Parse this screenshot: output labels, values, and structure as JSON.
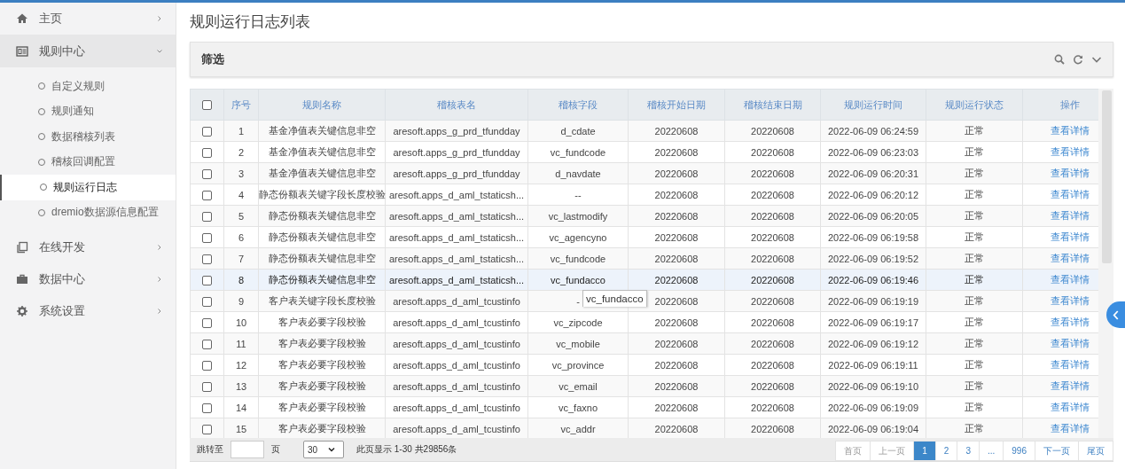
{
  "sidebar": {
    "items": [
      {
        "label": "主页",
        "kind": "home",
        "expanded": false
      },
      {
        "label": "规则中心",
        "kind": "card",
        "expanded": true,
        "children": [
          {
            "label": "自定义规则",
            "selected": false
          },
          {
            "label": "规则通知",
            "selected": false
          },
          {
            "label": "数据稽核列表",
            "selected": false
          },
          {
            "label": "稽核回调配置",
            "selected": false
          },
          {
            "label": "规则运行日志",
            "selected": true
          },
          {
            "label": "dremio数据源信息配置",
            "selected": false
          }
        ]
      },
      {
        "label": "在线开发",
        "kind": "copy",
        "expanded": false
      },
      {
        "label": "数据中心",
        "kind": "briefcase",
        "expanded": false
      },
      {
        "label": "系统设置",
        "kind": "gear",
        "expanded": false
      }
    ]
  },
  "page_title": "规则运行日志列表",
  "filter": {
    "title": "筛选"
  },
  "table": {
    "select_all_checked": false,
    "columns": [
      "序号",
      "规则名称",
      "稽核表名",
      "稽核字段",
      "稽核开始日期",
      "稽核结束日期",
      "规则运行时间",
      "规则运行状态",
      "操作"
    ],
    "rows": [
      {
        "checked": false,
        "hovered": false,
        "cells": [
          "1",
          "基金净值表关键信息非空",
          "aresoft.apps_g_prd_tfundday",
          "d_cdate",
          "20220608",
          "20220608",
          "2022-06-09 06:24:59",
          "正常"
        ],
        "action": "查看详情"
      },
      {
        "checked": false,
        "hovered": false,
        "cells": [
          "2",
          "基金净值表关键信息非空",
          "aresoft.apps_g_prd_tfundday",
          "vc_fundcode",
          "20220608",
          "20220608",
          "2022-06-09 06:23:03",
          "正常"
        ],
        "action": "查看详情"
      },
      {
        "checked": false,
        "hovered": false,
        "cells": [
          "3",
          "基金净值表关键信息非空",
          "aresoft.apps_g_prd_tfundday",
          "d_navdate",
          "20220608",
          "20220608",
          "2022-06-09 06:20:31",
          "正常"
        ],
        "action": "查看详情"
      },
      {
        "checked": false,
        "hovered": false,
        "cells": [
          "4",
          "静态份额表关键字段长度校验",
          "aresoft.apps_d_aml_tstaticsh...",
          "--",
          "20220608",
          "20220608",
          "2022-06-09 06:20:12",
          "正常"
        ],
        "action": "查看详情"
      },
      {
        "checked": false,
        "hovered": false,
        "cells": [
          "5",
          "静态份额表关键信息非空",
          "aresoft.apps_d_aml_tstaticsh...",
          "vc_lastmodify",
          "20220608",
          "20220608",
          "2022-06-09 06:20:05",
          "正常"
        ],
        "action": "查看详情"
      },
      {
        "checked": false,
        "hovered": false,
        "cells": [
          "6",
          "静态份额表关键信息非空",
          "aresoft.apps_d_aml_tstaticsh...",
          "vc_agencyno",
          "20220608",
          "20220608",
          "2022-06-09 06:19:58",
          "正常"
        ],
        "action": "查看详情"
      },
      {
        "checked": false,
        "hovered": false,
        "cells": [
          "7",
          "静态份额表关键信息非空",
          "aresoft.apps_d_aml_tstaticsh...",
          "vc_fundcode",
          "20220608",
          "20220608",
          "2022-06-09 06:19:52",
          "正常"
        ],
        "action": "查看详情"
      },
      {
        "checked": false,
        "hovered": true,
        "cells": [
          "8",
          "静态份额表关键信息非空",
          "aresoft.apps_d_aml_tstaticsh...",
          "vc_fundacco",
          "20220608",
          "20220608",
          "2022-06-09 06:19:46",
          "正常"
        ],
        "action": "查看详情"
      },
      {
        "checked": false,
        "hovered": false,
        "cells": [
          "9",
          "客户表关键字段长度校验",
          "aresoft.apps_d_aml_tcustinfo",
          "-",
          "20220608",
          "20220608",
          "2022-06-09 06:19:19",
          "正常"
        ],
        "action": "查看详情"
      },
      {
        "checked": false,
        "hovered": false,
        "cells": [
          "10",
          "客户表必要字段校验",
          "aresoft.apps_d_aml_tcustinfo",
          "vc_zipcode",
          "20220608",
          "20220608",
          "2022-06-09 06:19:17",
          "正常"
        ],
        "action": "查看详情"
      },
      {
        "checked": false,
        "hovered": false,
        "cells": [
          "11",
          "客户表必要字段校验",
          "aresoft.apps_d_aml_tcustinfo",
          "vc_mobile",
          "20220608",
          "20220608",
          "2022-06-09 06:19:12",
          "正常"
        ],
        "action": "查看详情"
      },
      {
        "checked": false,
        "hovered": false,
        "cells": [
          "12",
          "客户表必要字段校验",
          "aresoft.apps_d_aml_tcustinfo",
          "vc_province",
          "20220608",
          "20220608",
          "2022-06-09 06:19:11",
          "正常"
        ],
        "action": "查看详情"
      },
      {
        "checked": false,
        "hovered": false,
        "cells": [
          "13",
          "客户表必要字段校验",
          "aresoft.apps_d_aml_tcustinfo",
          "vc_email",
          "20220608",
          "20220608",
          "2022-06-09 06:19:10",
          "正常"
        ],
        "action": "查看详情"
      },
      {
        "checked": false,
        "hovered": false,
        "cells": [
          "14",
          "客户表必要字段校验",
          "aresoft.apps_d_aml_tcustinfo",
          "vc_faxno",
          "20220608",
          "20220608",
          "2022-06-09 06:19:09",
          "正常"
        ],
        "action": "查看详情"
      },
      {
        "checked": false,
        "hovered": false,
        "cells": [
          "15",
          "客户表必要字段校验",
          "aresoft.apps_d_aml_tcustinfo",
          "vc_addr",
          "20220608",
          "20220608",
          "2022-06-09 06:19:04",
          "正常"
        ],
        "action": "查看详情"
      }
    ],
    "tooltip": "vc_fundacco"
  },
  "footer": {
    "jump_label": "跳转至",
    "page_label": "页",
    "page_size": "30",
    "info": "此页显示 1-30 共29856条",
    "pages": [
      {
        "label": "首页",
        "selected": false
      },
      {
        "label": "上一页",
        "selected": false
      },
      {
        "label": "1",
        "selected": true
      },
      {
        "label": "2",
        "selected": false
      },
      {
        "label": "3",
        "selected": false
      },
      {
        "label": "...",
        "selected": false
      },
      {
        "label": "996",
        "selected": false
      },
      {
        "label": "下一页",
        "selected": false
      },
      {
        "label": "尾页",
        "selected": false
      }
    ]
  }
}
